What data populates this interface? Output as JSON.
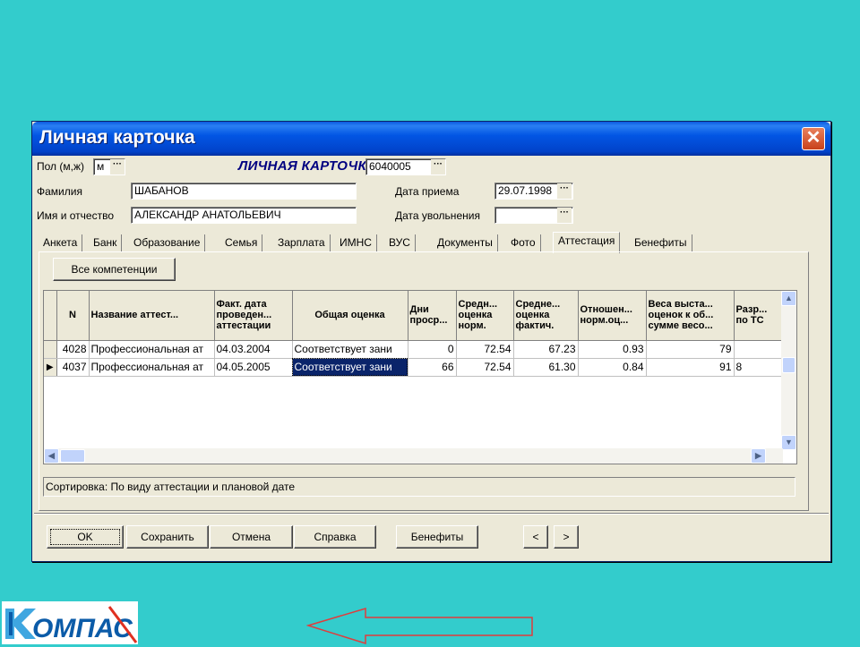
{
  "window": {
    "title": "Личная карточка",
    "close_label": "✕"
  },
  "header": {
    "gender_label": "Пол (м,ж)",
    "gender_value": "м",
    "doc_title": "ЛИЧНАЯ КАРТОЧКА",
    "doc_number": "6040005",
    "surname_label": "Фамилия",
    "surname_value": "ШАБАНОВ",
    "name_label": "Имя и отчество",
    "name_value": "АЛЕКСАНДР АНАТОЛЬЕВИЧ",
    "hire_date_label": "Дата приема",
    "hire_date_value": "29.07.1998",
    "fire_date_label": "Дата увольнения",
    "fire_date_value": "",
    "ellipsis": "···"
  },
  "tabs": [
    "Анкета",
    "Банк",
    "Образование",
    "Семья",
    "Зарплата",
    "ИМНС",
    "ВУС",
    "Документы",
    "Фото",
    "Аттестация",
    "Бенефиты"
  ],
  "active_tab": "Аттестация",
  "panel": {
    "all_competencies_label": "Все компетенции",
    "columns": [
      "N",
      "Название аттест...",
      "Факт. дата проведен... аттестации",
      "Общая оценка",
      "Дни проср...",
      "Средн... оценка норм.",
      "Средне... оценка фактич.",
      "Отношен... норм.оц...",
      "Веса выста... оценок к об... сумме весо...",
      "Разр... по ТС"
    ],
    "rows": [
      {
        "n": "4028",
        "name": "Профессиональная ат",
        "date": "04.03.2004",
        "grade": "Соответствует зани",
        "days": "0",
        "avg_norm": "72.54",
        "avg_fact": "67.23",
        "ratio": "0.93",
        "weights": "79",
        "rank": ""
      },
      {
        "n": "4037",
        "name": "Профессиональная ат",
        "date": "04.05.2005",
        "grade": "Соответствует зани",
        "days": "66",
        "avg_norm": "72.54",
        "avg_fact": "61.30",
        "ratio": "0.84",
        "weights": "91",
        "rank": "8"
      }
    ],
    "status_text": "Сортировка: По виду аттестации и плановой дате"
  },
  "buttons": {
    "ok": "OK",
    "save": "Сохранить",
    "cancel": "Отмена",
    "help": "Справка",
    "benefits": "Бенефиты",
    "prev": "<",
    "next": ">"
  },
  "logo": {
    "text": "КОМПАС"
  },
  "colors": {
    "background": "#33cccc",
    "title_bar": "#0256e4",
    "accent": "#000080"
  }
}
